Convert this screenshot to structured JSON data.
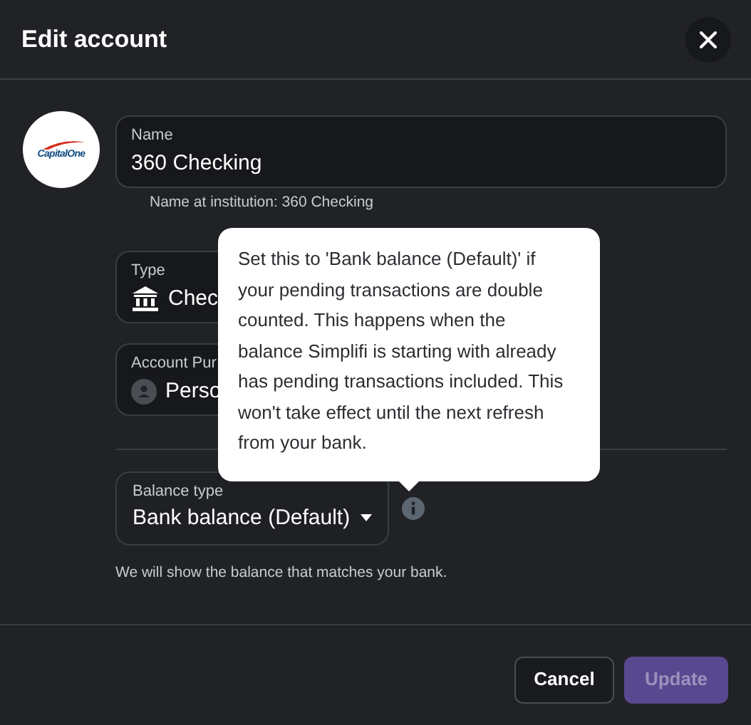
{
  "dialog": {
    "title": "Edit account"
  },
  "logo": {
    "text": "CapitalOne"
  },
  "name_field": {
    "label": "Name",
    "value": "360 Checking",
    "hint": "Name at institution: 360 Checking"
  },
  "type_field": {
    "label": "Type",
    "value": "Chec"
  },
  "purpose_field": {
    "label": "Account Pur",
    "value": "Perso"
  },
  "balance_field": {
    "label": "Balance type",
    "value": "Bank balance (Default)",
    "hint": "We will show the balance that matches your bank."
  },
  "tooltip": {
    "text": "Set this to 'Bank balance (Default)' if your pending transactions are double counted. This happens when the balance Simplifi is starting with already has pending transactions included. This won't take effect until the next refresh from your bank."
  },
  "buttons": [
    {
      "label": "Cancel",
      "kind": "secondary",
      "disabled": false
    },
    {
      "label": "Update",
      "kind": "primary",
      "disabled": true
    }
  ]
}
